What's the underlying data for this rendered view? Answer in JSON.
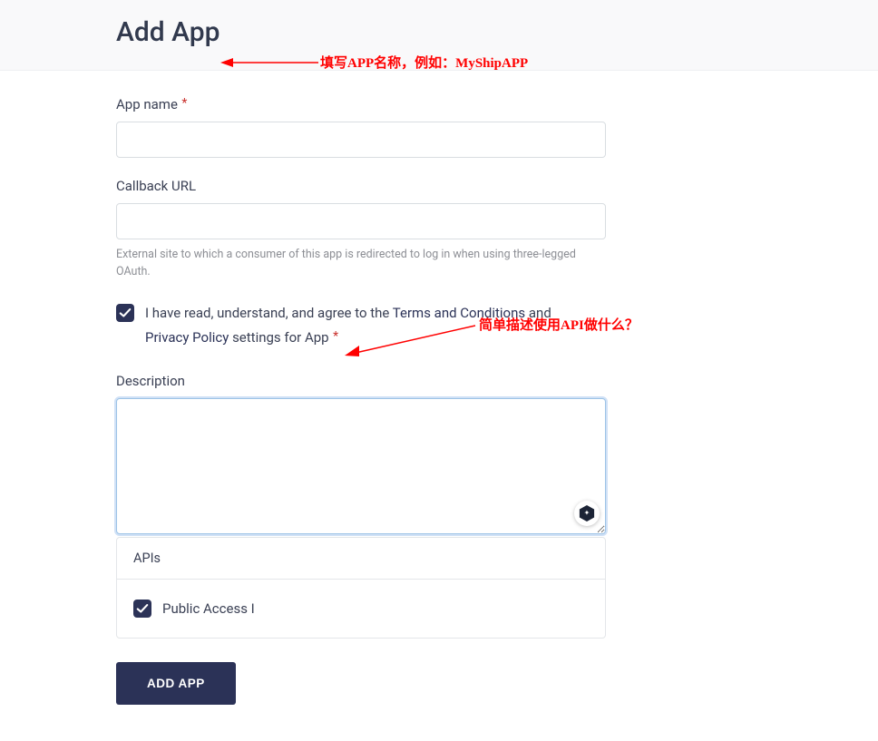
{
  "header": {
    "title": "Add App"
  },
  "annotations": {
    "app_name_hint": "填写APP名称，例如：MyShipAPP",
    "description_hint": "简单描述使用API做什么？"
  },
  "form": {
    "app_name": {
      "label": "App name",
      "value": ""
    },
    "callback_url": {
      "label": "Callback URL",
      "value": "",
      "help": "External site to which a consumer of this app is redirected to log in when using three-legged OAuth."
    },
    "agreement": {
      "checked": true,
      "text_prefix": "I have read, understand, and agree to the ",
      "terms_link": "Terms and Conditions",
      "text_mid": " and ",
      "privacy_link": "Privacy Policy",
      "text_suffix": " settings for App"
    },
    "description": {
      "label": "Description",
      "value": ""
    },
    "apis_panel": {
      "header": "APIs",
      "public_access": {
        "checked": true,
        "label": "Public Access I"
      }
    },
    "submit_label": "ADD APP"
  }
}
